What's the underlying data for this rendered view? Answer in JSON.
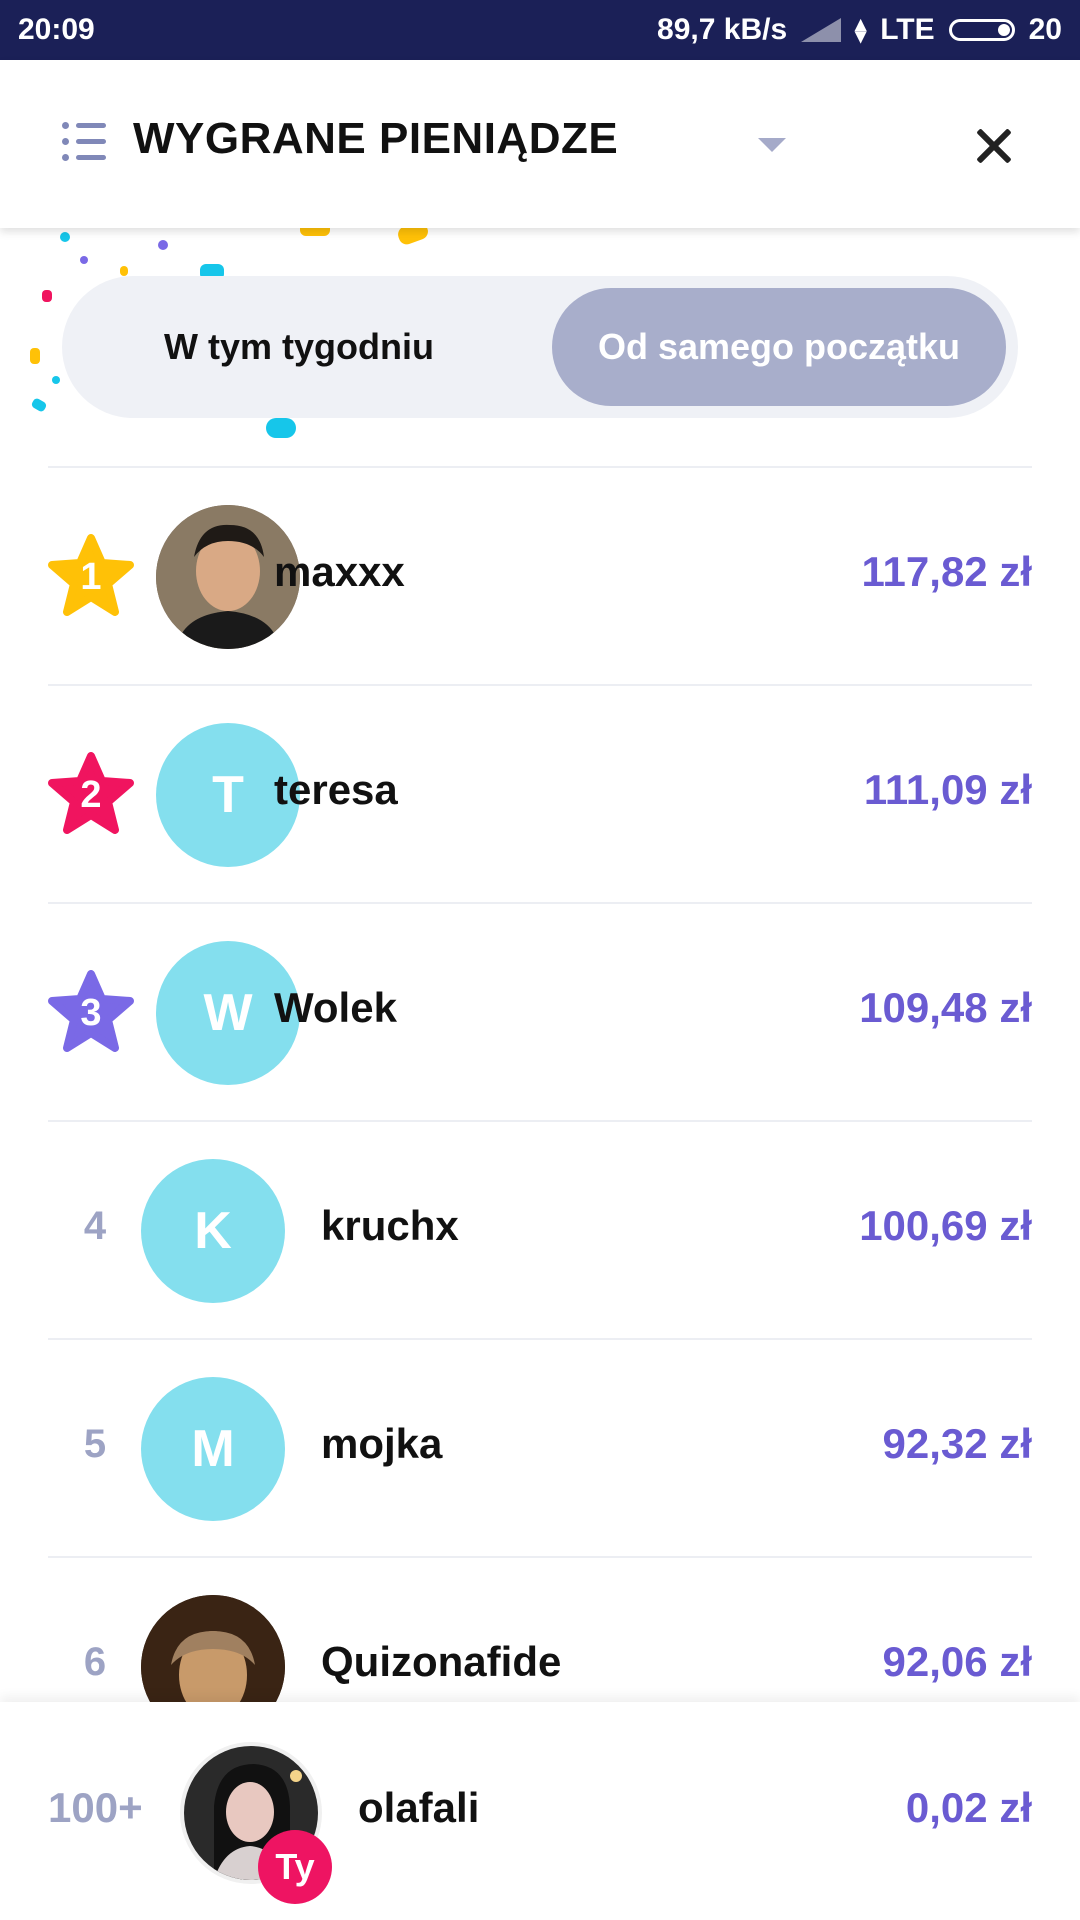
{
  "status_bar": {
    "time": "20:09",
    "net_speed": "89,7 kB/s",
    "network": "LTE",
    "battery": "20"
  },
  "header": {
    "title": "WYGRANE PIENIĄDZE",
    "menu_icon": "list-icon",
    "dropdown_icon": "chevron-down-icon",
    "close_icon": "close-icon"
  },
  "toggle": {
    "options": [
      "W tym tygodniu",
      "Od samego początku"
    ],
    "selected": "Od samego początku"
  },
  "colors": {
    "accent_amount": "#6a5bd2",
    "rank1": "#ffc107",
    "rank2": "#f0145f",
    "rank3": "#7a69e6",
    "avatar_bg": "#84dfee",
    "toggle_selected": "#a8aecb"
  },
  "leaderboard": [
    {
      "rank": "1",
      "name": "maxxx",
      "amount": "117,82 zł",
      "initial": "",
      "avatar": "photo"
    },
    {
      "rank": "2",
      "name": "teresa",
      "amount": "111,09 zł",
      "initial": "T",
      "avatar": "initial"
    },
    {
      "rank": "3",
      "name": "Wolek",
      "amount": "109,48 zł",
      "initial": "W",
      "avatar": "initial"
    },
    {
      "rank": "4",
      "name": "kruchx",
      "amount": "100,69 zł",
      "initial": "K",
      "avatar": "initial"
    },
    {
      "rank": "5",
      "name": "mojka",
      "amount": "92,32 zł",
      "initial": "M",
      "avatar": "initial"
    },
    {
      "rank": "6",
      "name": "Quizonafide",
      "amount": "92,06 zł",
      "initial": "",
      "avatar": "photo"
    }
  ],
  "me": {
    "rank": "100+",
    "name": "olafali",
    "amount": "0,02 zł",
    "badge": "Ty"
  }
}
